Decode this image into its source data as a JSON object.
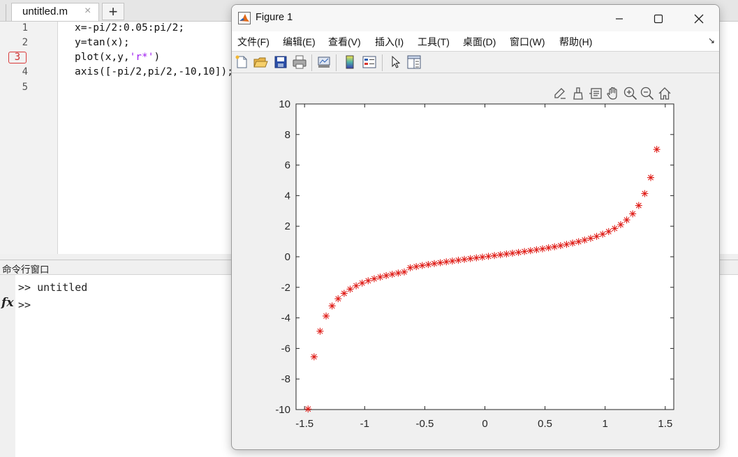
{
  "editor": {
    "tab_title": "untitled.m",
    "tab_close": "×",
    "add_tab": "+",
    "line_numbers": [
      "1",
      "2",
      "3",
      "4",
      "5"
    ],
    "breakpoint_line": "3",
    "code": {
      "line1": "x=-pi/2:0.05:pi/2;",
      "line2": "y=tan(x);",
      "line3_pre": "plot(x,y,",
      "line3_str": "'r*'",
      "line3_post": ")",
      "line4": "axis([-pi/2,pi/2,-10,10]);"
    }
  },
  "command_window": {
    "title": "命令行窗口",
    "fx": "fx",
    "history": ">> untitled",
    "prompt": ">>"
  },
  "figure": {
    "title": "Figure 1",
    "controls": [
      "minimize",
      "maximize",
      "close"
    ],
    "menu": [
      "文件(F)",
      "编辑(E)",
      "查看(V)",
      "插入(I)",
      "工具(T)",
      "桌面(D)",
      "窗口(W)",
      "帮助(H)"
    ],
    "toolbar_icons": [
      "new-figure-icon",
      "open-file-icon",
      "save-icon",
      "print-icon",
      "link-plot-icon",
      "colorbar-icon",
      "legend-icon",
      "edit-plot-arrow-icon",
      "property-inspector-icon"
    ],
    "axes_toolbar_icons": [
      "export-icon",
      "brush-icon",
      "data-tips-icon",
      "pan-icon",
      "zoom-in-icon",
      "zoom-out-icon",
      "home-icon"
    ]
  },
  "chart_data": {
    "type": "scatter",
    "marker": "*",
    "color": "#e0201b",
    "title": "",
    "xlabel": "",
    "ylabel": "",
    "xlim": [
      -1.5707963,
      1.5707963
    ],
    "ylim": [
      -10,
      10
    ],
    "x": [
      -1.4708,
      -1.4208,
      -1.3708,
      -1.3208,
      -1.2708,
      -1.2208,
      -1.1708,
      -1.1208,
      -1.0708,
      -1.0208,
      -0.9708,
      -0.9208,
      -0.8708,
      -0.8208,
      -0.7708,
      -0.7208,
      -0.6708,
      -0.6208,
      -0.5708,
      -0.5208,
      -0.4708,
      -0.4208,
      -0.3708,
      -0.3208,
      -0.2708,
      -0.2208,
      -0.1708,
      -0.1208,
      -0.0708,
      -0.0208,
      0.0292,
      0.0792,
      0.1292,
      0.1792,
      0.2292,
      0.2792,
      0.3292,
      0.3792,
      0.4292,
      0.4792,
      0.5292,
      0.5792,
      0.6292,
      0.6792,
      0.7292,
      0.7792,
      0.8292,
      0.8792,
      0.9292,
      0.9792,
      1.0292,
      1.0792,
      1.1292,
      1.1792,
      1.2292,
      1.2792,
      1.3292,
      1.3792,
      1.4292
    ],
    "y": [
      -9.967,
      -6.548,
      -4.872,
      -3.878,
      -3.218,
      -2.748,
      -2.396,
      -2.121,
      -1.901,
      -1.721,
      -1.569,
      -1.441,
      -1.329,
      -1.231,
      -1.145,
      -1.066,
      -0.996,
      -0.717,
      -0.643,
      -0.573,
      -0.509,
      -0.447,
      -0.389,
      -0.332,
      -0.278,
      -0.225,
      -0.172,
      -0.121,
      -0.071,
      -0.021,
      0.029,
      0.079,
      0.13,
      0.181,
      0.233,
      0.287,
      0.342,
      0.398,
      0.457,
      0.52,
      0.586,
      0.655,
      0.728,
      0.811,
      0.895,
      0.989,
      1.094,
      1.207,
      1.333,
      1.479,
      1.648,
      1.852,
      2.1,
      2.41,
      2.811,
      3.355,
      4.134,
      5.181,
      7.025
    ],
    "xticks": [
      -1.5,
      -1,
      -0.5,
      0,
      0.5,
      1,
      1.5
    ],
    "xtick_labels": [
      "-1.5",
      "-1",
      "-0.5",
      "0",
      "0.5",
      "1",
      "1.5"
    ],
    "yticks": [
      -10,
      -8,
      -6,
      -4,
      -2,
      0,
      2,
      4,
      6,
      8,
      10
    ],
    "ytick_labels": [
      "-10",
      "-8",
      "-6",
      "-4",
      "-2",
      "0",
      "2",
      "4",
      "6",
      "8",
      "10"
    ],
    "grid": false
  }
}
